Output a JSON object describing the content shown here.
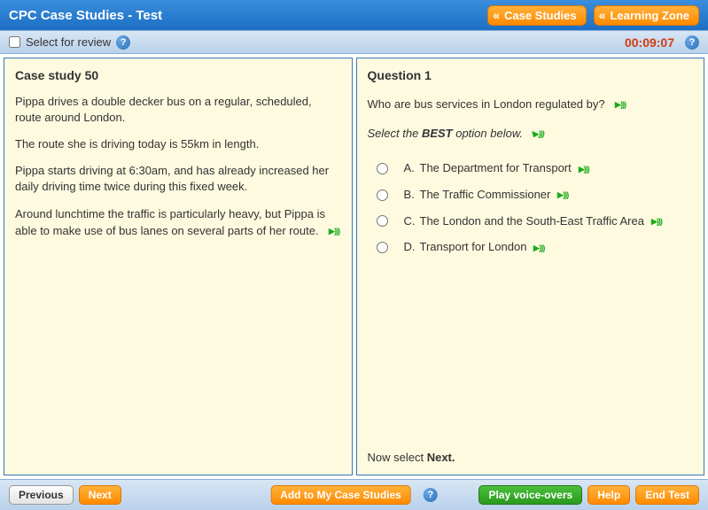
{
  "header": {
    "title": "CPC Case Studies - Test",
    "buttons": {
      "case_studies": "Case Studies",
      "learning_zone": "Learning Zone"
    }
  },
  "review": {
    "label": "Select for review",
    "timer": "00:09:07"
  },
  "caseStudy": {
    "title": "Case study 50",
    "p1": "Pippa drives a double decker bus on a regular, scheduled, route around London.",
    "p2": "The route she is driving today is 55km in length.",
    "p3": "Pippa starts driving at 6:30am, and has already increased her daily driving time twice during this fixed week.",
    "p4": "Around lunchtime the traffic is particularly heavy, but Pippa is able to make use of bus lanes on several parts of her route."
  },
  "question": {
    "title": "Question 1",
    "text": "Who are bus services in London regulated by?",
    "instruction_prefix": "Select the ",
    "instruction_bold": "BEST",
    "instruction_suffix": " option below.",
    "options": {
      "a_letter": "A.",
      "a_text": "The Department for Transport",
      "b_letter": "B.",
      "b_text": "The Traffic Commissioner",
      "c_letter": "C.",
      "c_text": "The London and the South-East Traffic Area",
      "d_letter": "D.",
      "d_text": "Transport for London"
    },
    "next_hint_prefix": "Now select ",
    "next_hint_bold": "Next."
  },
  "footer": {
    "previous": "Previous",
    "next": "Next",
    "add": "Add to My Case Studies",
    "play": "Play voice-overs",
    "help": "Help",
    "end": "End Test"
  }
}
